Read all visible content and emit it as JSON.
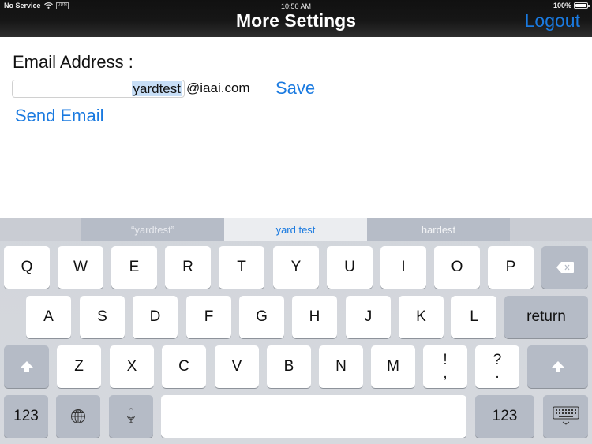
{
  "status_bar": {
    "carrier": "No Service",
    "vpn": "VPN",
    "time": "10:50 AM",
    "battery": "100%",
    "battery_level": 1.0
  },
  "nav": {
    "title": "More Settings",
    "logout_label": "Logout"
  },
  "form": {
    "email_label": "Email Address :",
    "email_value": "yardtest",
    "email_domain": "@iaai.com",
    "save_label": "Save",
    "send_email_label": "Send Email"
  },
  "keyboard": {
    "suggestions": [
      "“yardtest”",
      "yard test",
      "hardest"
    ],
    "row1": [
      "Q",
      "W",
      "E",
      "R",
      "T",
      "Y",
      "U",
      "I",
      "O",
      "P"
    ],
    "row2": [
      "A",
      "S",
      "D",
      "F",
      "G",
      "H",
      "J",
      "K",
      "L"
    ],
    "row3": [
      "Z",
      "X",
      "C",
      "V",
      "B",
      "N",
      "M"
    ],
    "punct1": {
      "top": "!",
      "bottom": ","
    },
    "punct2": {
      "top": "?",
      "bottom": "."
    },
    "return_label": "return",
    "numbers_label": "123",
    "icons": {
      "backspace": "backspace-icon",
      "shift": "shift-icon",
      "globe": "globe-icon",
      "mic": "microphone-icon",
      "hide": "keyboard-hide-icon",
      "wifi": "wifi-icon",
      "battery": "battery-icon"
    }
  }
}
